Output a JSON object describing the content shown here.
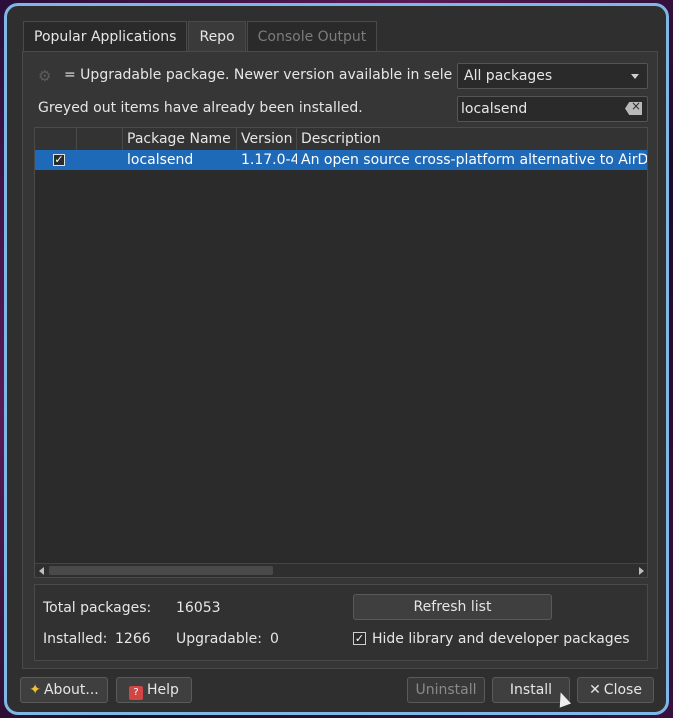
{
  "tabs": [
    {
      "label": "Popular Applications",
      "state": "normal"
    },
    {
      "label": "Repo",
      "state": "active"
    },
    {
      "label": "Console Output",
      "state": "disabled"
    }
  ],
  "filter": {
    "legend_icon": "gear-icon",
    "legend_text": "= Upgradable package. Newer version available in sele",
    "selected": "All packages",
    "hint": "Greyed out items have already been installed.",
    "search_value": "localsend"
  },
  "table": {
    "headers": [
      "",
      "",
      "Package Name",
      "Version",
      "Description"
    ],
    "rows": [
      {
        "checked": true,
        "name": "localsend",
        "version": "1.17.0-4",
        "description": "An open source cross-platform alternative to AirD"
      }
    ]
  },
  "stats": {
    "total_label": "Total packages:",
    "total_value": "16053",
    "installed_label": "Installed:",
    "installed_value": "1266",
    "upgradable_label": "Upgradable:",
    "upgradable_value": "0",
    "refresh_label": "Refresh list",
    "hide_label": "Hide library and developer packages",
    "hide_checked": true
  },
  "footer": {
    "about_label": "About...",
    "help_label": "Help",
    "uninstall_label": "Uninstall",
    "install_label": "Install",
    "close_label": "Close"
  },
  "colors": {
    "selection": "#1f6ab8",
    "window_border": "#7fb8e6",
    "background": "#2f2f2f"
  }
}
